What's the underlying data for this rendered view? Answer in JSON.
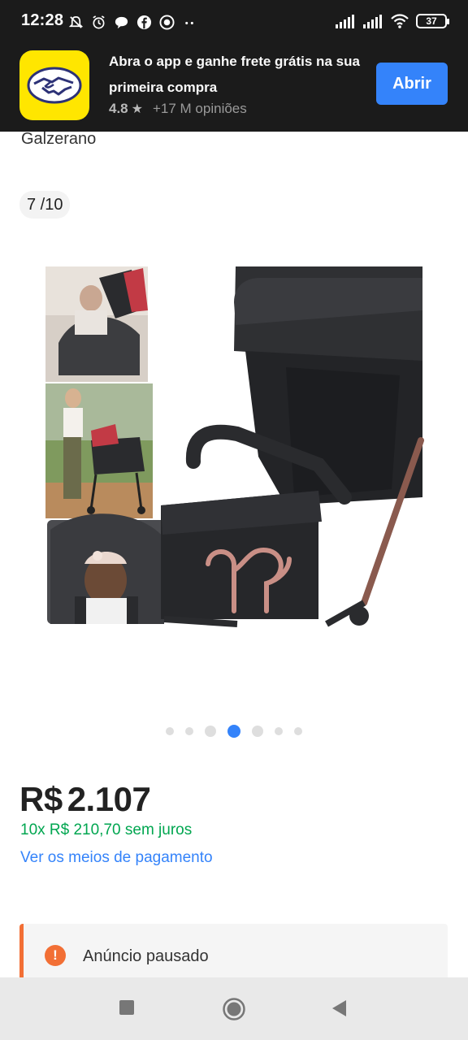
{
  "status_bar": {
    "time": "12:28",
    "battery": "37",
    "icons": [
      "mute-icon",
      "alarm-icon",
      "chat-icon",
      "facebook-icon",
      "record-icon",
      "more-dots-icon",
      "signal-icon",
      "signal-icon-2",
      "wifi-icon",
      "battery-icon"
    ]
  },
  "banner": {
    "message": "Abra o app e ganhe frete grátis na sua primeira compra",
    "rating": "4.8",
    "reviews": "+17 M opiniões",
    "open_label": "Abrir",
    "accent": "#3483fa",
    "logo_color": "#ffe600"
  },
  "product": {
    "title_fragment": "Galzerano",
    "image_counter": "7 /10",
    "price_currency": "R$",
    "price_value": "2.107",
    "installments": "10x R$ 210,70 sem juros",
    "payment_link": "Ver os meios de pagamento"
  },
  "carousel": {
    "total_dots": 7,
    "active_index": 3
  },
  "notice": {
    "text": "Anúncio pausado",
    "color": "#f26f35"
  },
  "nav": {
    "icons": [
      "recents-square-icon",
      "home-circle-icon",
      "back-triangle-icon"
    ]
  }
}
